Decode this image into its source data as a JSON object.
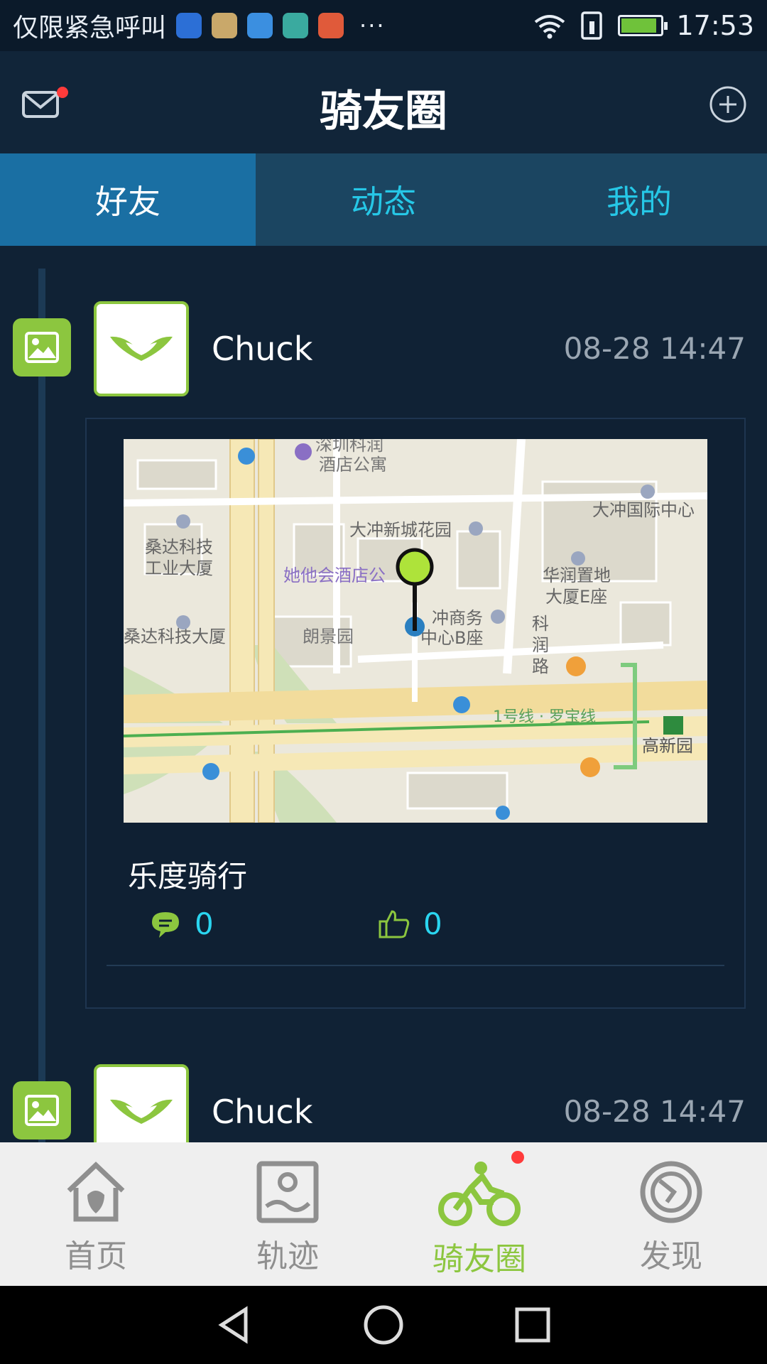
{
  "status_bar": {
    "carrier_text": "仅限紧急呼叫",
    "more": "···",
    "time": "17:53",
    "battery_level": 0.9
  },
  "header": {
    "title": "骑友圈",
    "icons": {
      "left": "mail-icon",
      "right": "add-circle-icon"
    }
  },
  "tabs": [
    {
      "label": "好友",
      "active": true
    },
    {
      "label": "动态",
      "active": false
    },
    {
      "label": "我的",
      "active": false
    }
  ],
  "posts": [
    {
      "user_name": "Chuck",
      "time": "08-28 14:47",
      "text": "乐度骑行",
      "comments": "0",
      "likes": "0",
      "map_labels": [
        "深圳科润酒店公寓",
        "大冲新城花园",
        "大冲国际中心",
        "桑达科技工业大厦",
        "她他会酒店公",
        "华润置地大厦E座",
        "桑达科技大厦",
        "朗景园",
        "冲商务中心B座",
        "科润路",
        "1号线 罗宝线",
        "高新园"
      ]
    },
    {
      "user_name": "Chuck",
      "time": "08-28 14:47"
    }
  ],
  "bottom_nav": [
    {
      "label": "首页",
      "icon": "home-icon",
      "active": false
    },
    {
      "label": "轨迹",
      "icon": "track-icon",
      "active": false
    },
    {
      "label": "骑友圈",
      "icon": "cyclist-icon",
      "active": true
    },
    {
      "label": "发现",
      "icon": "discover-icon",
      "active": false
    }
  ],
  "colors": {
    "accent_green": "#8cc63f",
    "tab_active": "#1a6fa3",
    "tab_text": "#26c7e6",
    "background": "#102235"
  }
}
